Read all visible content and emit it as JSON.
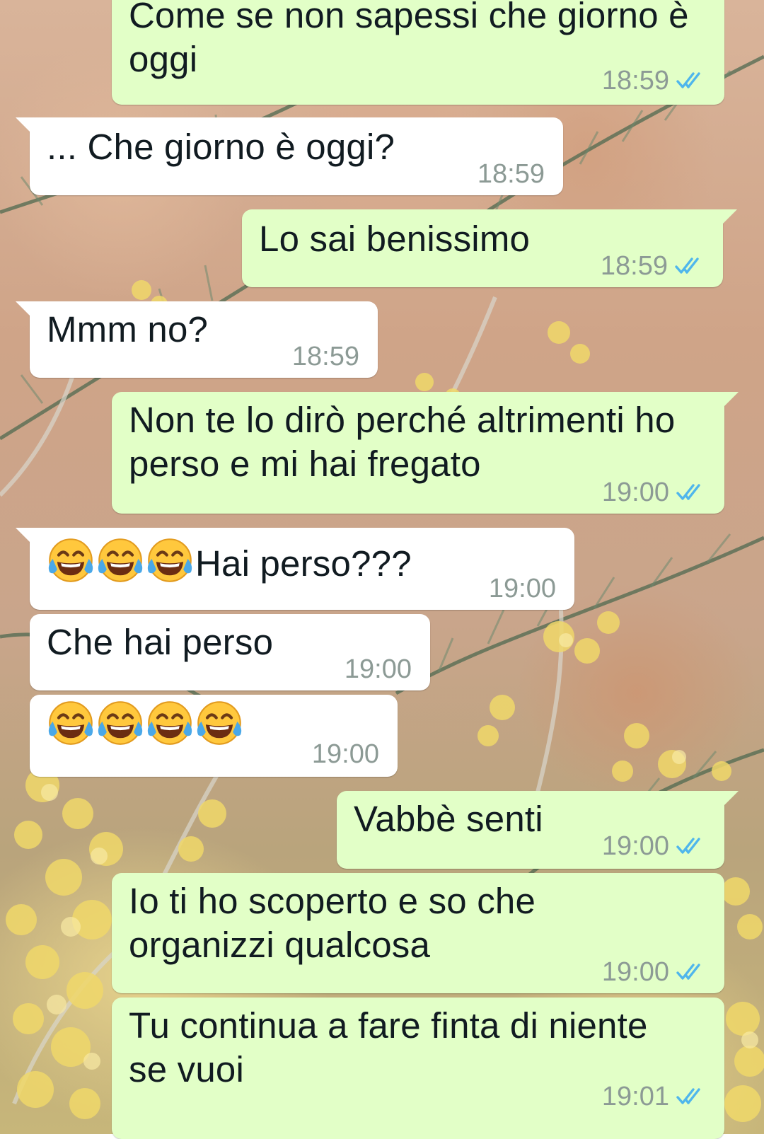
{
  "chat": {
    "messages": [
      {
        "direction": "outgoing",
        "lines": [
          "Come se non sapessi che giorno è",
          "oggi"
        ],
        "time": "18:59",
        "status": "read"
      },
      {
        "direction": "incoming",
        "text": "... Che giorno è oggi?",
        "time": "18:59"
      },
      {
        "direction": "outgoing",
        "text": "Lo sai benissimo",
        "time": "18:59",
        "status": "read"
      },
      {
        "direction": "incoming",
        "text": "Mmm no?",
        "time": "18:59"
      },
      {
        "direction": "outgoing",
        "lines": [
          "Non te lo dirò perché altrimenti ho",
          "perso e mi hai fregato"
        ],
        "time": "19:00",
        "status": "read"
      },
      {
        "direction": "incoming",
        "emoji_prefix": [
          "face-with-tears-of-joy",
          "face-with-tears-of-joy",
          "face-with-tears-of-joy"
        ],
        "text": "Hai perso???",
        "time": "19:00"
      },
      {
        "direction": "incoming",
        "text": "Che hai perso",
        "time": "19:00"
      },
      {
        "direction": "incoming",
        "emoji_only": [
          "face-with-tears-of-joy",
          "face-with-tears-of-joy",
          "face-with-tears-of-joy",
          "face-with-tears-of-joy"
        ],
        "time": "19:00"
      },
      {
        "direction": "outgoing",
        "text": "Vabbè senti",
        "time": "19:00",
        "status": "read"
      },
      {
        "direction": "outgoing",
        "lines": [
          "Io ti ho scoperto e so che",
          "organizzi qualcosa"
        ],
        "time": "19:00",
        "status": "read"
      },
      {
        "direction": "outgoing",
        "lines": [
          "Tu continua a fare finta di niente",
          "se vuoi"
        ],
        "time": "19:01",
        "status": "read"
      }
    ]
  },
  "icons": {
    "read_receipt": "double-check-icon",
    "emoji": "face-with-tears-of-joy"
  },
  "colors": {
    "outgoing_bubble": "#e2ffc7",
    "incoming_bubble": "#ffffff",
    "timestamp": "#8c9a95",
    "read_ticks": "#4fb6ec",
    "text": "#111b21"
  }
}
